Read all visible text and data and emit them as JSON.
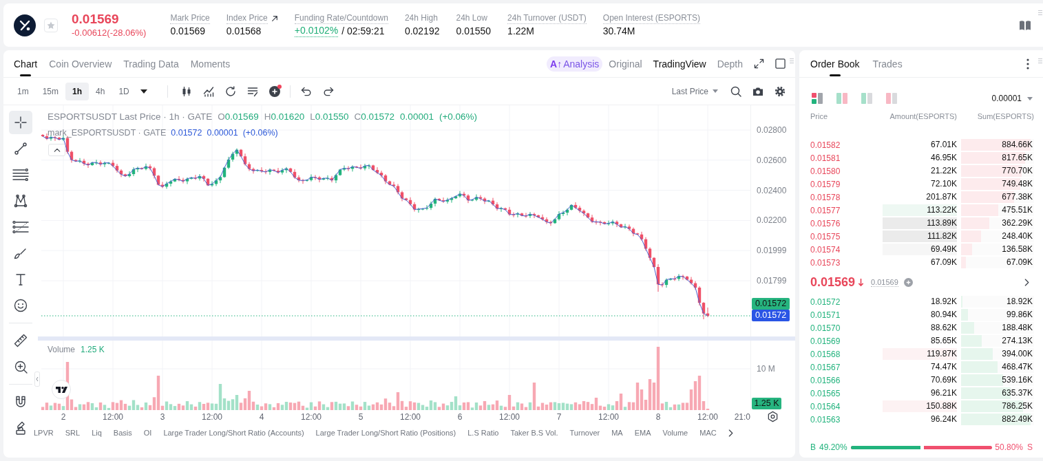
{
  "header": {
    "price": "0.01569",
    "change": "-0.00612(-28.06%)",
    "favorite": false,
    "stats": [
      {
        "kind": "plain",
        "label": "Mark Price",
        "value": "0.01569",
        "tooltip": true
      },
      {
        "kind": "link",
        "label": "Index Price",
        "value": "0.01568",
        "tooltip": true
      },
      {
        "kind": "funding",
        "label": "Funding Rate/Countdown",
        "value": "+0.0102%",
        "countdown": "/ 02:59:21",
        "tooltip": true
      },
      {
        "kind": "plain",
        "label": "24h High",
        "value": "0.02192",
        "tooltip": false
      },
      {
        "kind": "plain",
        "label": "24h Low",
        "value": "0.01550",
        "tooltip": false
      },
      {
        "kind": "plain",
        "label": "24h Turnover (USDT)",
        "value": "1.22M",
        "tooltip": true
      },
      {
        "kind": "plain",
        "label": "Open Interest (ESPORTS)",
        "value": "30.74M",
        "tooltip": true
      }
    ]
  },
  "chart_panel": {
    "tabs": [
      {
        "label": "Chart",
        "selected": true
      },
      {
        "label": "Coin Overview",
        "selected": false
      },
      {
        "label": "Trading Data",
        "selected": false
      },
      {
        "label": "Moments",
        "selected": false
      }
    ],
    "views": [
      {
        "kind": "ai",
        "badge": "A↑",
        "label": "Analysis",
        "selected": false
      },
      {
        "kind": "plain",
        "label": "Original",
        "selected": false
      },
      {
        "kind": "plain",
        "label": "TradingView",
        "selected": true
      },
      {
        "kind": "plain",
        "label": "Depth",
        "selected": false
      }
    ],
    "intervals": [
      {
        "label": "1m",
        "selected": false
      },
      {
        "label": "15m",
        "selected": false
      },
      {
        "label": "1h",
        "selected": true
      },
      {
        "label": "4h",
        "selected": false
      },
      {
        "label": "1D",
        "selected": false
      }
    ],
    "indicator_alert": true,
    "price_source": "Last Price",
    "tools": [
      [
        {
          "kind": "crosshair",
          "selected": true
        },
        {
          "kind": "trend-line",
          "selected": false
        },
        {
          "kind": "parallel-lines",
          "selected": false
        },
        {
          "kind": "pattern",
          "selected": false
        },
        {
          "kind": "fib",
          "selected": false
        },
        {
          "kind": "brush",
          "selected": false
        },
        {
          "kind": "text",
          "selected": false
        },
        {
          "kind": "emoji",
          "selected": false
        }
      ],
      [
        {
          "kind": "ruler",
          "selected": false
        },
        {
          "kind": "zoom-in",
          "selected": false
        }
      ],
      [
        {
          "kind": "magnet",
          "selected": false
        },
        {
          "kind": "lock",
          "selected": false
        }
      ]
    ],
    "legend": {
      "title": "ESPORTSUSDT Last Price · 1h · GATE",
      "ohlc": [
        {
          "key": "O",
          "value": "0.01569"
        },
        {
          "key": "H",
          "value": "0.01620"
        },
        {
          "key": "L",
          "value": "0.01550"
        },
        {
          "key": "C",
          "value": "0.01572"
        }
      ],
      "change": "0.00001",
      "change_pct": "(+0.06%)"
    },
    "mark_legend": {
      "title": "mark_ESPORTSUSDT · GATE",
      "value": "0.01572",
      "change": "0.00001",
      "change_pct": "(+0.06%)"
    },
    "price_axis": [
      "0.02800",
      "0.02600",
      "0.02400",
      "0.02200",
      "0.01999",
      "0.01799"
    ],
    "price_tags": [
      {
        "text": "0.01572",
        "color": "#26b47f"
      },
      {
        "text": "0.01572",
        "color": "#2a55e5"
      }
    ],
    "volume": {
      "label": "Volume",
      "value": "1.25 K",
      "axis_label": "10 M",
      "tag": "1.25 K"
    },
    "time_axis": [
      "2",
      "12:00",
      "3",
      "12:00",
      "4",
      "12:00",
      "5",
      "12:00",
      "6",
      "12:00",
      "7",
      "12:00",
      "8",
      "12:00",
      "21:0"
    ],
    "indicators": [
      "LPVR",
      "SRL",
      "Liq",
      "Basis",
      "OI",
      "Large Trader Long/Short Ratio (Accounts)",
      "Large Trader Long/Short Ratio (Positions)",
      "L.S Ratio",
      "Taker B.S Vol.",
      "Turnover",
      "MA",
      "EMA",
      "Volume",
      "MAC"
    ]
  },
  "order_book": {
    "tabs": [
      {
        "label": "Order Book",
        "selected": true
      },
      {
        "label": "Trades",
        "selected": false
      }
    ],
    "layouts": [
      {
        "kind": "both",
        "selected": true
      },
      {
        "kind": "split",
        "selected": false
      },
      {
        "kind": "bids",
        "selected": false
      },
      {
        "kind": "asks",
        "selected": false
      }
    ],
    "precision": "0.00001",
    "columns": [
      "Price",
      "Amount(ESPORTS)",
      "Sum(ESPORTS)"
    ],
    "asks": [
      {
        "price": "0.01582",
        "amount": "67.01K",
        "sum": "884.66K",
        "level": 0.95
      },
      {
        "price": "0.01581",
        "amount": "46.95K",
        "sum": "817.65K",
        "level": 0.88
      },
      {
        "price": "0.01580",
        "amount": "21.22K",
        "sum": "770.70K",
        "level": 0.83
      },
      {
        "price": "0.01579",
        "amount": "72.10K",
        "sum": "749.48K",
        "level": 0.81
      },
      {
        "price": "0.01578",
        "amount": "201.87K",
        "sum": "677.38K",
        "level": 0.73
      },
      {
        "price": "0.01577",
        "amount": "113.22K",
        "sum": "475.51K",
        "level": 0.51,
        "color": "#eef8f3"
      },
      {
        "price": "0.01576",
        "amount": "113.89K",
        "sum": "362.29K",
        "level": 0.39,
        "color": "#ebebeb"
      },
      {
        "price": "0.01575",
        "amount": "111.82K",
        "sum": "248.40K",
        "level": 0.27,
        "color": "#ebebeb"
      },
      {
        "price": "0.01574",
        "amount": "69.49K",
        "sum": "136.58K",
        "level": 0.15,
        "color": "#f6f6f6"
      },
      {
        "price": "0.01573",
        "amount": "67.09K",
        "sum": "67.09K",
        "level": 0.07
      }
    ],
    "last": {
      "price": "0.01569",
      "down": true,
      "mark": "0.01569"
    },
    "bids": [
      {
        "price": "0.01572",
        "amount": "18.92K",
        "sum": "18.92K",
        "level": 0.02
      },
      {
        "price": "0.01571",
        "amount": "80.94K",
        "sum": "99.86K",
        "level": 0.09
      },
      {
        "price": "0.01570",
        "amount": "88.62K",
        "sum": "188.48K",
        "level": 0.18
      },
      {
        "price": "0.01569",
        "amount": "85.65K",
        "sum": "274.13K",
        "level": 0.28
      },
      {
        "price": "0.01568",
        "amount": "119.87K",
        "sum": "394.00K",
        "level": 0.43,
        "color": "#fdf2f3"
      },
      {
        "price": "0.01567",
        "amount": "74.47K",
        "sum": "468.47K",
        "level": 0.5
      },
      {
        "price": "0.01566",
        "amount": "70.69K",
        "sum": "539.16K",
        "level": 0.58
      },
      {
        "price": "0.01565",
        "amount": "96.21K",
        "sum": "635.37K",
        "level": 0.68
      },
      {
        "price": "0.01564",
        "amount": "150.88K",
        "sum": "786.25K",
        "level": 0.85,
        "color": "#fdf2f3"
      },
      {
        "price": "0.01563",
        "amount": "96.24K",
        "sum": "882.49K",
        "level": 0.95
      }
    ],
    "ratio": {
      "buy_label": "B",
      "buy": "49.20%",
      "sell": "50.80%",
      "sell_label": "S",
      "level": 0.492
    }
  }
}
